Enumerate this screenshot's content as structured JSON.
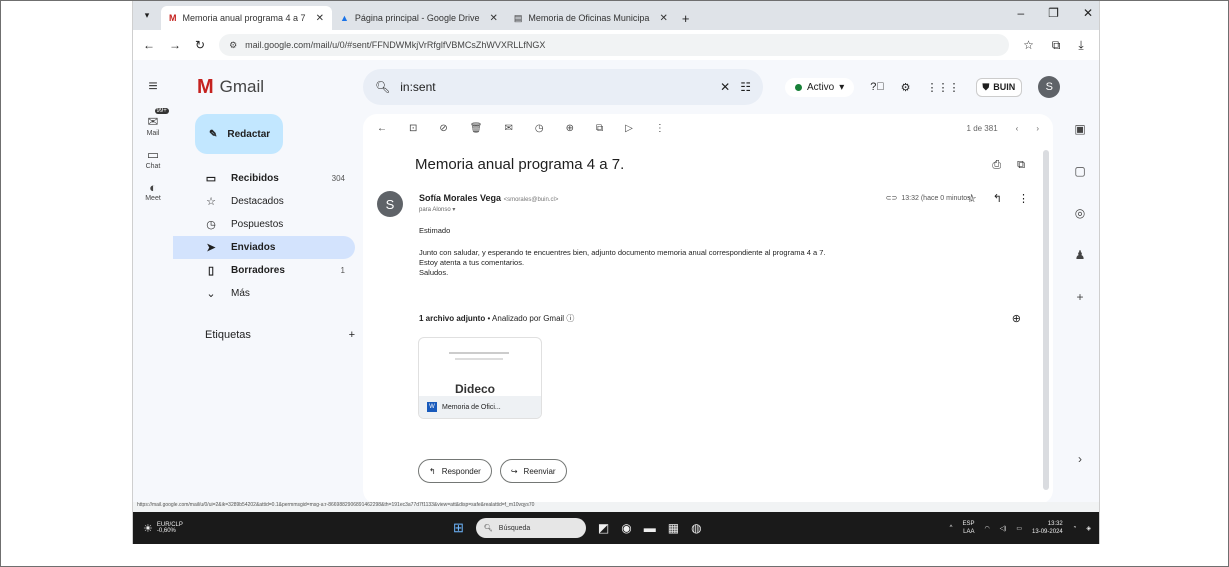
{
  "browser": {
    "tabs": [
      {
        "label": "Memoria anual programa 4 a 7",
        "icon": "M",
        "active": true
      },
      {
        "label": "Página principal - Google Drive",
        "icon": "▲",
        "active": false
      },
      {
        "label": "Memoria de Oficinas Municipa",
        "icon": "▤",
        "active": false
      }
    ],
    "url": "mail.google.com/mail/u/0/#sent/FFNDWMkjVrRfglfVBMCsZhWVXRLLfNGX"
  },
  "gmail": {
    "product_name": "Gmail",
    "search_value": "in:sent",
    "status": "Activo",
    "org_badge": "BUIN",
    "account_initial": "S"
  },
  "rail": {
    "mail_label": "Mail",
    "mail_badge": "99+",
    "chat_label": "Chat",
    "meet_label": "Meet"
  },
  "nav": {
    "compose": "Redactar",
    "items": [
      {
        "label": "Recibidos",
        "count": "304",
        "icon": "▭"
      },
      {
        "label": "Destacados",
        "count": "",
        "icon": "☆"
      },
      {
        "label": "Pospuestos",
        "count": "",
        "icon": "◷"
      },
      {
        "label": "Enviados",
        "count": "",
        "icon": "➤"
      },
      {
        "label": "Borradores",
        "count": "1",
        "icon": "▯"
      },
      {
        "label": "Más",
        "count": "",
        "icon": "⌄"
      }
    ],
    "labels_heading": "Etiquetas"
  },
  "message": {
    "pager": "1 de 381",
    "subject": "Memoria anual programa 4 a 7.",
    "sender_initial": "S",
    "sender_name": "Sofía Morales Vega",
    "sender_email": "<smorales@buin.cl>",
    "to_line": "para Alonso",
    "time": "13:32 (hace 0 minutos)",
    "body": {
      "greeting": "Estimado",
      "line1": "Junto con saludar, y esperando te encuentres bien, adjunto documento memoria anual correspondiente al programa 4 a 7.",
      "line2": "Estoy atenta a tus comentarios.",
      "closing": "Saludos."
    },
    "attachment_header": "1 archivo adjunto",
    "attachment_scan": "• Analizado por Gmail",
    "attachment_preview_text": "Dideco",
    "attachment_name": "Memoria de Ofici...",
    "reply": "Responder",
    "forward": "Reenviar"
  },
  "statusbar": {
    "link": "https://mail.google.com/mail/u/0/ui=2&ik=3289b54202&attid=0.1&permmsgid=msg-a:r-8669882906891462298&th=191ec3a77d7f1133&view=att&disp=safe&realattid=f_m10vqys70"
  },
  "taskbar": {
    "weather_title": "EUR/CLP",
    "weather_value": "-0,60%",
    "search": "Búsqueda",
    "lang1": "ESP",
    "lang2": "LAA",
    "time": "13:32",
    "date": "13-09-2024"
  }
}
